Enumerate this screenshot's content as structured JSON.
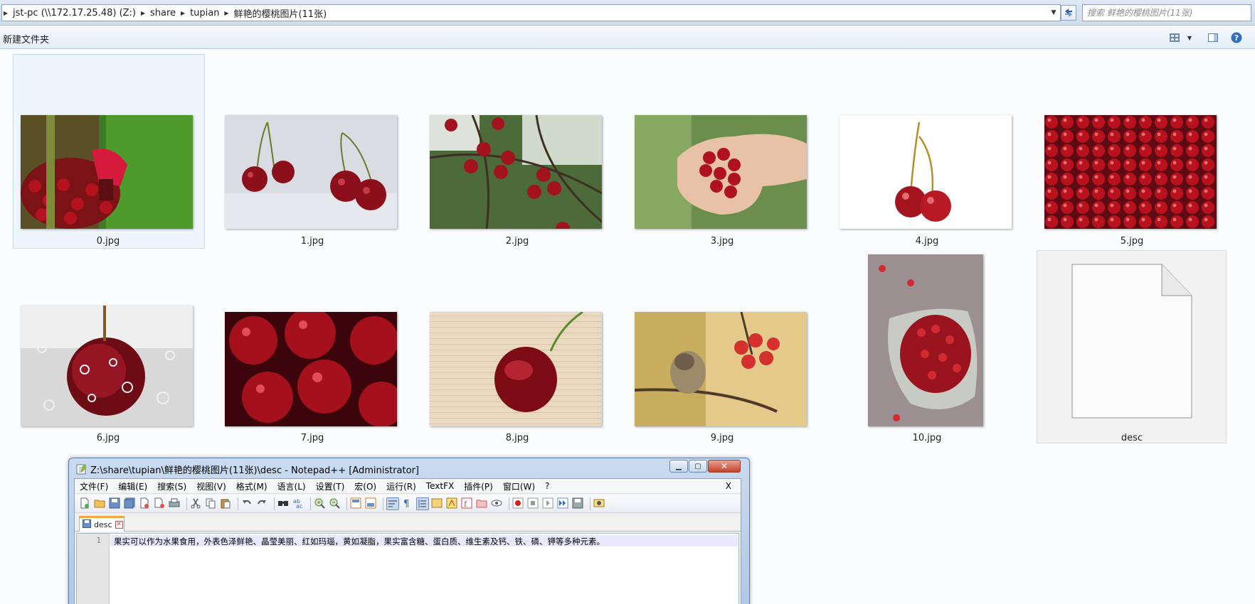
{
  "address_bar": {
    "crumbs": [
      "jst-pc (\\\\172.17.25.48) (Z:)",
      "share",
      "tupian",
      "鲜艳的樱桃图片(11张)"
    ]
  },
  "search": {
    "placeholder": "搜索 鲜艳的樱桃图片(11张)"
  },
  "command_bar": {
    "new_folder_label": "新建文件夹"
  },
  "files": [
    {
      "name": "0.jpg",
      "selected": true
    },
    {
      "name": "1.jpg"
    },
    {
      "name": "2.jpg"
    },
    {
      "name": "3.jpg"
    },
    {
      "name": "4.jpg"
    },
    {
      "name": "5.jpg"
    },
    {
      "name": "6.jpg"
    },
    {
      "name": "7.jpg"
    },
    {
      "name": "8.jpg"
    },
    {
      "name": "9.jpg"
    },
    {
      "name": "10.jpg"
    },
    {
      "name": "desc"
    }
  ],
  "notepad": {
    "title": "Z:\\share\\tupian\\鲜艳的樱桃图片(11张)\\desc - Notepad++ [Administrator]",
    "menu": [
      "文件(F)",
      "编辑(E)",
      "搜索(S)",
      "视图(V)",
      "格式(M)",
      "语言(L)",
      "设置(T)",
      "宏(O)",
      "运行(R)",
      "TextFX",
      "插件(P)",
      "窗口(W)",
      "?"
    ],
    "menu_close": "X",
    "tab_label": "desc",
    "line_number": "1",
    "line_text": "果实可以作为水果食用，外表色泽鲜艳、晶莹美丽、红如玛瑙，黄如凝脂，果实富含糖、蛋白质、维生素及钙、铁、磷、钾等多种元素。"
  },
  "colors": {
    "accent_blue": "#2c63a8",
    "tab_highlight": "#f4a53c",
    "close_red": "#c5432a"
  }
}
